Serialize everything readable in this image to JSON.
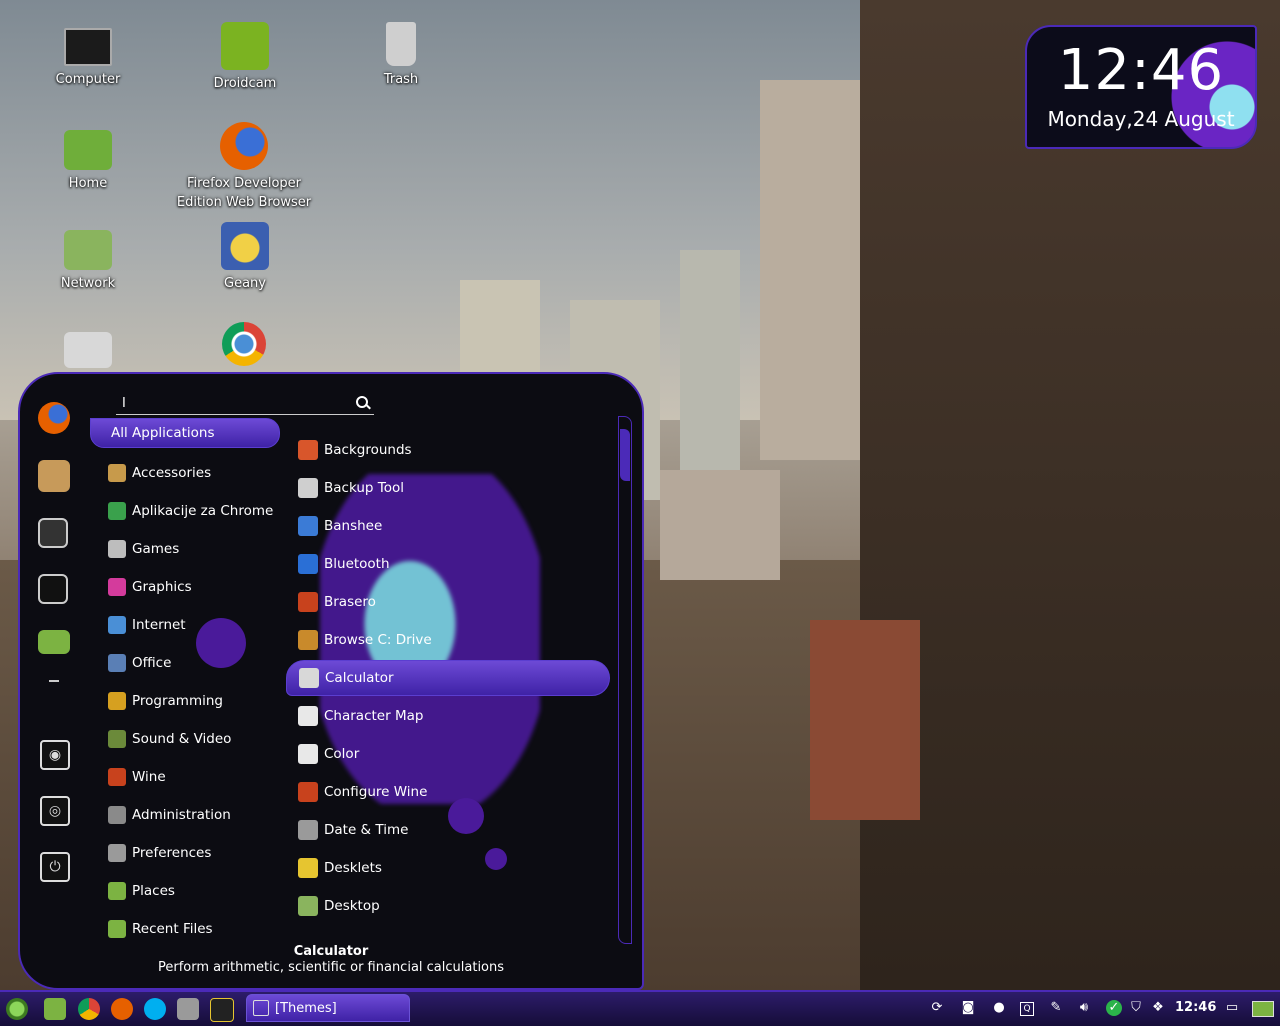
{
  "desktop_icons": [
    {
      "label": "Computer",
      "icon": "monitor-icon",
      "color": "#1b1b1b"
    },
    {
      "label": "Droidcam",
      "icon": "droidcam-icon",
      "color": "#7bb321"
    },
    {
      "label": "Trash",
      "icon": "trash-icon",
      "color": "#cfcfcf"
    },
    {
      "label": "Home",
      "icon": "home-folder-icon",
      "color": "#6fae3a"
    },
    {
      "label": "Firefox Developer Edition Web Browser",
      "icon": "firefox-icon",
      "color": "#e66000"
    },
    {
      "label": "Network",
      "icon": "network-folder-icon",
      "color": "#8ab45e"
    },
    {
      "label": "Geany",
      "icon": "geany-icon",
      "color": "#3b5fb0"
    },
    {
      "label": "",
      "icon": "usb-drive-icon",
      "color": "#d8d8d8"
    },
    {
      "label": "",
      "icon": "chrome-icon",
      "color": "#e3b415"
    }
  ],
  "clock": {
    "time": "12:46",
    "date": "Monday,24 August"
  },
  "menu": {
    "search_text": "I",
    "favorites": [
      "firefox-icon",
      "package-icon",
      "system-settings-icon",
      "terminal-icon",
      "folder-icon"
    ],
    "system_buttons": [
      "lock-screen-icon",
      "logout-icon",
      "shutdown-icon"
    ],
    "all_label": "All Applications",
    "categories": [
      {
        "label": "Accessories",
        "color": "#c79a4b"
      },
      {
        "label": "Aplikacije za Chrome",
        "color": "#3aa14c"
      },
      {
        "label": "Games",
        "color": "#bdbdbd"
      },
      {
        "label": "Graphics",
        "color": "#d43b9c"
      },
      {
        "label": "Internet",
        "color": "#4a8fd6"
      },
      {
        "label": "Office",
        "color": "#5a7fb5"
      },
      {
        "label": "Programming",
        "color": "#d6a020"
      },
      {
        "label": "Sound & Video",
        "color": "#6b8a3a"
      },
      {
        "label": "Wine",
        "color": "#c8421d"
      },
      {
        "label": "Administration",
        "color": "#8a8a8a"
      },
      {
        "label": "Preferences",
        "color": "#9a9a9a"
      },
      {
        "label": "Places",
        "color": "#7cb342"
      },
      {
        "label": "Recent Files",
        "color": "#7cb342"
      }
    ],
    "apps": [
      {
        "label": "Backgrounds",
        "color": "#d8562b"
      },
      {
        "label": "Backup Tool",
        "color": "#cfcfcf"
      },
      {
        "label": "Banshee",
        "color": "#3b7bd6"
      },
      {
        "label": "Bluetooth",
        "color": "#2a6fd6"
      },
      {
        "label": "Brasero",
        "color": "#c8421d"
      },
      {
        "label": "Browse C: Drive",
        "color": "#c98a2b"
      },
      {
        "label": "Calculator",
        "color": "#d8d8d8"
      },
      {
        "label": "Character Map",
        "color": "#e8e8e8"
      },
      {
        "label": "Color",
        "color": "#e8e8e8"
      },
      {
        "label": "Configure Wine",
        "color": "#c8421d"
      },
      {
        "label": "Date & Time",
        "color": "#9a9a9a"
      },
      {
        "label": "Desklets",
        "color": "#e6c530"
      },
      {
        "label": "Desktop",
        "color": "#8ab45e"
      }
    ],
    "selected_app": "Calculator",
    "description_title": "Calculator",
    "description_text": "Perform arithmetic, scientific or financial calculations"
  },
  "panel": {
    "launchers": [
      "menu-icon",
      "files-icon",
      "chrome-icon",
      "firefox-icon",
      "skype-icon",
      "clapper-icon",
      "system-monitor-icon"
    ],
    "task_label": "[Themes]",
    "tray": [
      "refresh-icon",
      "camera-icon",
      "user-icon",
      "keyboard-icon",
      "pen-icon",
      "volume-icon",
      "update-check-icon",
      "shield-icon",
      "dropbox-icon"
    ],
    "time": "12:46",
    "tray_right": [
      "display-icon",
      "show-desktop-icon"
    ]
  },
  "colors": {
    "accent": "#4b2ab8",
    "menu_bg": "#0c0c12"
  }
}
